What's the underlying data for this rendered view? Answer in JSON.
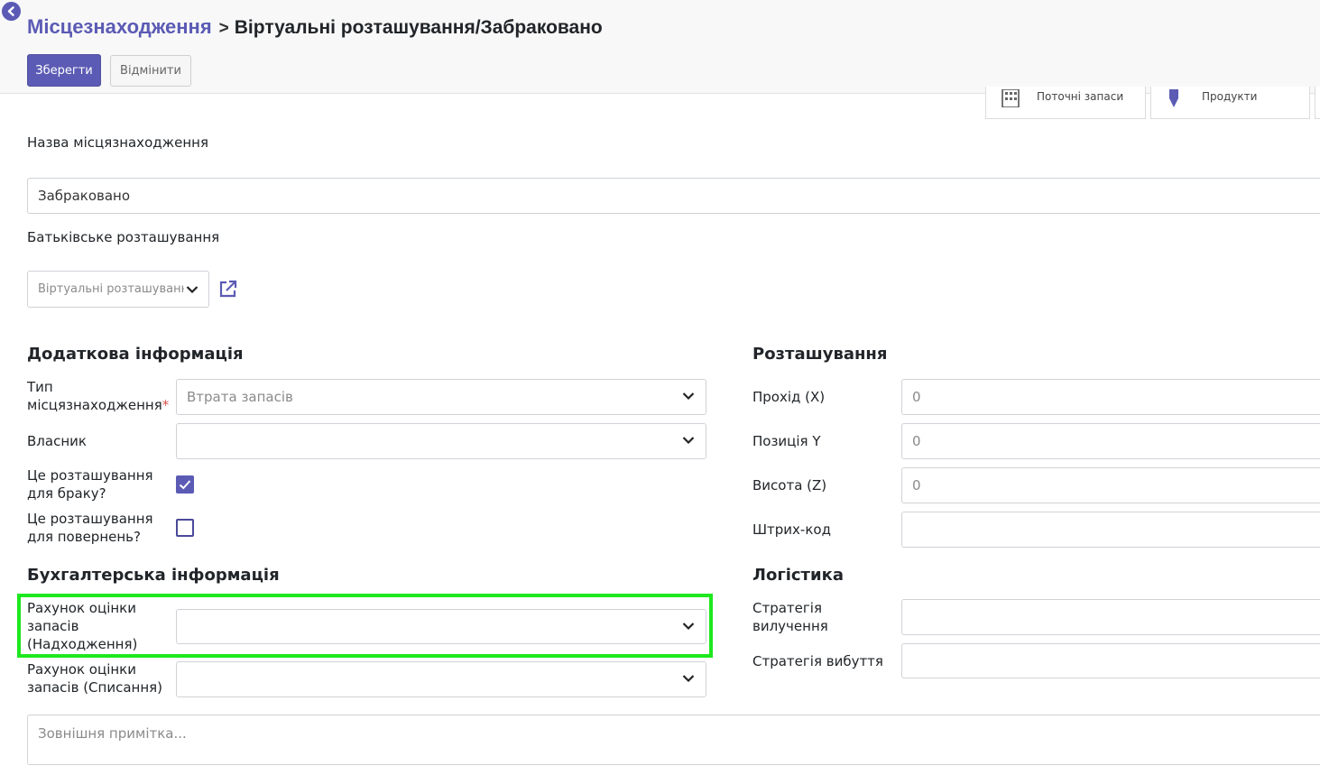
{
  "breadcrumb": {
    "parent": "Місцезнаходження",
    "separator": ">",
    "current": "Віртуальні розташування/Забраковано"
  },
  "actions": {
    "save": "Зберегти",
    "discard": "Відмінити"
  },
  "smart_buttons": [
    {
      "label": "Поточні запаси",
      "icon": "building-icon"
    },
    {
      "label": "Продукти",
      "icon": "tag-icon"
    }
  ],
  "form": {
    "name_label": "Назва місцязнаходження",
    "name_value": "Забраковано",
    "parent_label": "Батьківське розташування",
    "parent_value": "Віртуальні розташуванн"
  },
  "additional": {
    "title": "Додаткова інформація",
    "type_label_1": "Тип",
    "type_label_2": "місцязнаходження",
    "required_mark": "*",
    "type_value": "Втрата запасів",
    "owner_label": "Власник",
    "owner_value": "",
    "scrap_label_1": "Це розташування",
    "scrap_label_2": "для браку?",
    "scrap_checked": true,
    "return_label_1": "Це розташування",
    "return_label_2": "для повернень?",
    "return_checked": false
  },
  "location": {
    "title": "Розташування",
    "x_label": "Прохід (X)",
    "x_value": "0",
    "y_label": "Позиція Y",
    "y_value": "0",
    "z_label": "Висота (Z)",
    "z_value": "0",
    "barcode_label": "Штрих-код",
    "barcode_value": ""
  },
  "accounting": {
    "title": "Бухгалтерська інформація",
    "in_label_1": "Рахунок оцінки",
    "in_label_2": "запасів",
    "in_label_3": "(Надходження)",
    "in_value": "",
    "out_label_1": "Рахунок оцінки",
    "out_label_2": "запасів (Списання)",
    "out_value": ""
  },
  "logistics": {
    "title": "Логістика",
    "removal_label_1": "Стратегія",
    "removal_label_2": "вилучення",
    "removal_value": "",
    "putaway_label": "Стратегія вибуття",
    "putaway_value": ""
  },
  "note": {
    "placeholder": "Зовнішня примітка..."
  },
  "colors": {
    "accent": "#5b5bb5",
    "highlight": "#1ee81e"
  }
}
